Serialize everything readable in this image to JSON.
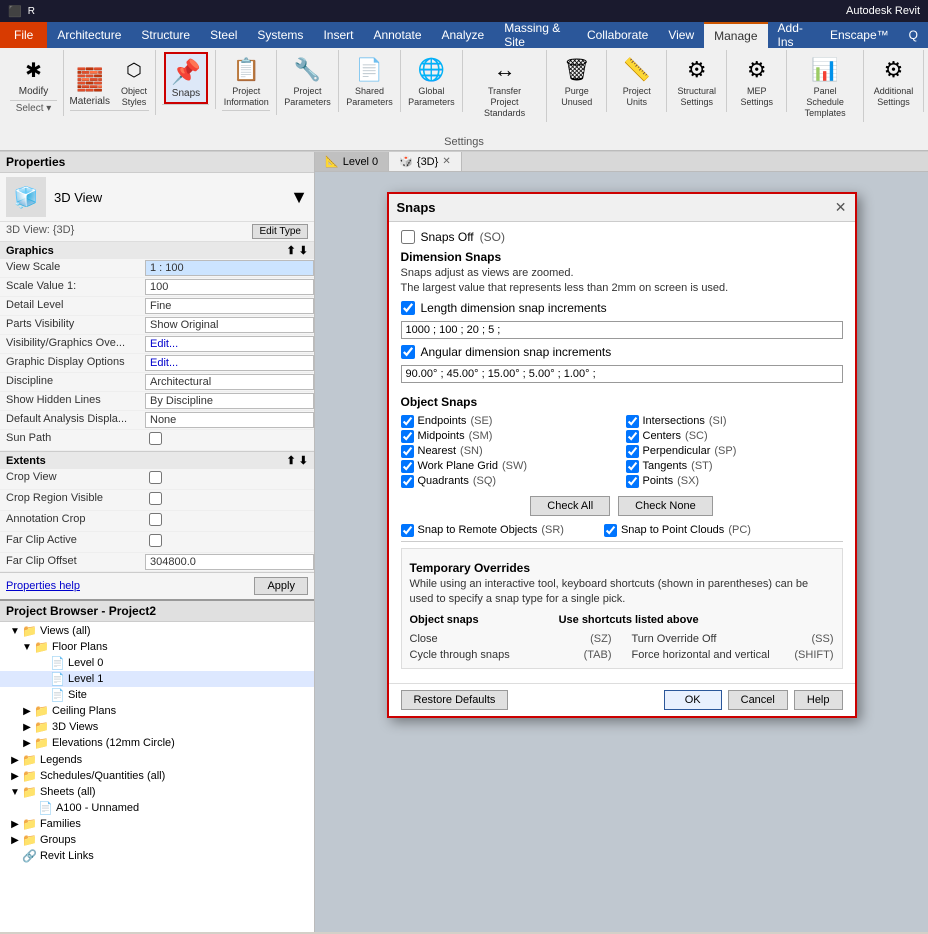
{
  "titlebar": {
    "text": "Autodesk Revit"
  },
  "ribbon": {
    "tabs": [
      {
        "label": "File",
        "type": "file"
      },
      {
        "label": "Architecture",
        "type": "normal"
      },
      {
        "label": "Structure",
        "type": "normal"
      },
      {
        "label": "Steel",
        "type": "normal"
      },
      {
        "label": "Systems",
        "type": "normal"
      },
      {
        "label": "Insert",
        "type": "normal"
      },
      {
        "label": "Annotate",
        "type": "normal"
      },
      {
        "label": "Analyze",
        "type": "normal"
      },
      {
        "label": "Massing & Site",
        "type": "normal"
      },
      {
        "label": "Collaborate",
        "type": "normal"
      },
      {
        "label": "View",
        "type": "normal"
      },
      {
        "label": "Manage",
        "type": "active"
      },
      {
        "label": "Add-Ins",
        "type": "normal"
      },
      {
        "label": "Enscape™",
        "type": "normal"
      },
      {
        "label": "Q",
        "type": "normal"
      }
    ],
    "groups": [
      {
        "label": "",
        "buttons": [
          {
            "label": "Modify",
            "icon": "✱"
          }
        ]
      },
      {
        "label": "",
        "buttons": [
          {
            "label": "Materials",
            "icon": "🧱"
          },
          {
            "label": "Object Styles",
            "icon": "📐"
          }
        ]
      },
      {
        "label": "",
        "buttons": [
          {
            "label": "Snaps",
            "icon": "📌",
            "active": true
          }
        ]
      },
      {
        "label": "Project\nInformation",
        "buttons": [
          {
            "label": "Project\nInformation",
            "icon": "ℹ"
          }
        ]
      },
      {
        "label": "",
        "buttons": [
          {
            "label": "Project\nParameters",
            "icon": "🔧"
          }
        ]
      },
      {
        "label": "",
        "buttons": [
          {
            "label": "Shared\nParameters",
            "icon": "📋"
          }
        ]
      },
      {
        "label": "",
        "buttons": [
          {
            "label": "Global\nParameters",
            "icon": "🌐"
          }
        ]
      },
      {
        "label": "",
        "buttons": [
          {
            "label": "Transfer\nProject Standards",
            "icon": "↔"
          }
        ]
      },
      {
        "label": "",
        "buttons": [
          {
            "label": "Purge\nUnused",
            "icon": "🗑"
          }
        ]
      },
      {
        "label": "",
        "buttons": [
          {
            "label": "Project\nUnits",
            "icon": "📏"
          }
        ]
      },
      {
        "label": "Structural\nSettings",
        "buttons": [
          {
            "label": "Structural\nSettings",
            "icon": "⚙"
          }
        ]
      },
      {
        "label": "MEP\nSettings",
        "buttons": [
          {
            "label": "MEP\nSettings",
            "icon": "⚙"
          }
        ]
      },
      {
        "label": "Panel Schedule\nTemplates",
        "buttons": [
          {
            "label": "Panel Schedule\nTemplates",
            "icon": "📊"
          }
        ]
      },
      {
        "label": "Additional\nSettings",
        "buttons": [
          {
            "label": "Additional\nSettings",
            "icon": "⚙"
          }
        ]
      }
    ],
    "settings_label": "Settings"
  },
  "properties": {
    "title": "Properties",
    "view_name": "3D View",
    "view_label": "3D View: {3D}",
    "edit_type_label": "Edit Type",
    "sections": [
      {
        "name": "Graphics",
        "rows": [
          {
            "label": "View Scale",
            "value": "1 : 100",
            "highlight": true
          },
          {
            "label": "Scale Value  1:",
            "value": "100"
          },
          {
            "label": "Detail Level",
            "value": "Fine"
          },
          {
            "label": "Parts Visibility",
            "value": "Show Original"
          },
          {
            "label": "Visibility/Graphics Ove...",
            "value": "Edit...",
            "link": true
          },
          {
            "label": "Graphic Display Options",
            "value": "Edit...",
            "link": true
          },
          {
            "label": "Discipline",
            "value": "Architectural"
          },
          {
            "label": "Show Hidden Lines",
            "value": "By Discipline"
          },
          {
            "label": "Default Analysis Displa...",
            "value": "None"
          },
          {
            "label": "Sun Path",
            "value": "",
            "checkbox": true
          }
        ]
      },
      {
        "name": "Extents",
        "rows": [
          {
            "label": "Crop View",
            "value": "",
            "checkbox": true
          },
          {
            "label": "Crop Region Visible",
            "value": "",
            "checkbox": true
          },
          {
            "label": "Annotation Crop",
            "value": "",
            "checkbox": true
          },
          {
            "label": "Far Clip Active",
            "value": "",
            "checkbox": true
          },
          {
            "label": "Far Clip Offset",
            "value": "304800.0"
          }
        ]
      }
    ],
    "properties_help": "Properties help",
    "apply_label": "Apply"
  },
  "project_browser": {
    "title": "Project Browser - Project2",
    "tree": [
      {
        "level": 0,
        "label": "Views (all)",
        "expanded": true,
        "icon": "📁"
      },
      {
        "level": 1,
        "label": "Floor Plans",
        "expanded": true,
        "icon": "📁"
      },
      {
        "level": 2,
        "label": "Level 0",
        "icon": "📄"
      },
      {
        "level": 2,
        "label": "Level 1",
        "icon": "📄"
      },
      {
        "level": 2,
        "label": "Site",
        "icon": "📄"
      },
      {
        "level": 1,
        "label": "Ceiling Plans",
        "expanded": false,
        "icon": "📁"
      },
      {
        "level": 1,
        "label": "3D Views",
        "expanded": false,
        "icon": "📁"
      },
      {
        "level": 1,
        "label": "Elevations (12mm Circle)",
        "expanded": false,
        "icon": "📁"
      },
      {
        "level": 0,
        "label": "Legends",
        "expanded": false,
        "icon": "📁"
      },
      {
        "level": 0,
        "label": "Schedules/Quantities (all)",
        "expanded": false,
        "icon": "📁"
      },
      {
        "level": 0,
        "label": "Sheets (all)",
        "expanded": true,
        "icon": "📁"
      },
      {
        "level": 1,
        "label": "A100 - Unnamed",
        "icon": "📄"
      },
      {
        "level": 0,
        "label": "Families",
        "expanded": false,
        "icon": "📁"
      },
      {
        "level": 0,
        "label": "Groups",
        "expanded": false,
        "icon": "📁"
      },
      {
        "level": 0,
        "label": "Revit Links",
        "icon": "🔗"
      }
    ]
  },
  "view_tabs": [
    {
      "label": "Level 0",
      "icon": "📐",
      "closeable": false
    },
    {
      "label": "{3D}",
      "icon": "🎲",
      "closeable": true,
      "active": true
    }
  ],
  "dialog": {
    "title": "Snaps",
    "snaps_off": "Snaps Off",
    "snaps_off_key": "(SO)",
    "dimension_snaps_title": "Dimension Snaps",
    "dimension_snaps_desc1": "Snaps adjust as views are zoomed.",
    "dimension_snaps_desc2": "The largest value that represents less than 2mm on screen is used.",
    "length_label": "Length dimension snap increments",
    "length_value": "1000 ; 100 ; 20 ; 5 ;",
    "angular_label": "Angular dimension snap increments",
    "angular_value": "90.00° ; 45.00° ; 15.00° ; 5.00° ; 1.00° ;",
    "object_snaps_title": "Object Snaps",
    "snaps": [
      {
        "label": "Endpoints",
        "key": "(SE)",
        "checked": true,
        "col": 0,
        "row": 0
      },
      {
        "label": "Intersections",
        "key": "(SI)",
        "checked": true,
        "col": 1,
        "row": 0
      },
      {
        "label": "Midpoints",
        "key": "(SM)",
        "checked": true,
        "col": 0,
        "row": 1
      },
      {
        "label": "Centers",
        "key": "(SC)",
        "checked": true,
        "col": 1,
        "row": 1
      },
      {
        "label": "Nearest",
        "key": "(SN)",
        "checked": true,
        "col": 0,
        "row": 2
      },
      {
        "label": "Perpendicular",
        "key": "(SP)",
        "checked": true,
        "col": 1,
        "row": 2
      },
      {
        "label": "Work Plane Grid",
        "key": "(SW)",
        "checked": true,
        "col": 0,
        "row": 3
      },
      {
        "label": "Tangents",
        "key": "(ST)",
        "checked": true,
        "col": 1,
        "row": 3
      },
      {
        "label": "Quadrants",
        "key": "(SQ)",
        "checked": true,
        "col": 0,
        "row": 4
      },
      {
        "label": "Points",
        "key": "(SX)",
        "checked": true,
        "col": 1,
        "row": 4
      }
    ],
    "check_all_label": "Check All",
    "check_none_label": "Check None",
    "snap_to_remote": "Snap to Remote Objects",
    "snap_to_remote_key": "(SR)",
    "snap_to_remote_checked": true,
    "snap_to_point_clouds": "Snap to Point Clouds",
    "snap_to_point_clouds_key": "(PC)",
    "snap_to_point_clouds_checked": true,
    "temp_overrides_title": "Temporary Overrides",
    "temp_overrides_desc": "While using an interactive tool, keyboard shortcuts (shown in parentheses) can be used to specify a snap type for a single pick.",
    "temp_col1_header": "Object snaps",
    "temp_col2_header": "Use shortcuts listed above",
    "temp_items": [
      {
        "label": "Close",
        "key": "(SZ)"
      },
      {
        "label": "Turn Override Off",
        "key": "(SS)"
      },
      {
        "label": "Cycle through snaps",
        "key": "(TAB)"
      },
      {
        "label": "Force horizontal and vertical",
        "key": "(SHIFT)"
      }
    ],
    "restore_defaults_label": "Restore Defaults",
    "ok_label": "OK",
    "cancel_label": "Cancel",
    "help_label": "Help"
  }
}
